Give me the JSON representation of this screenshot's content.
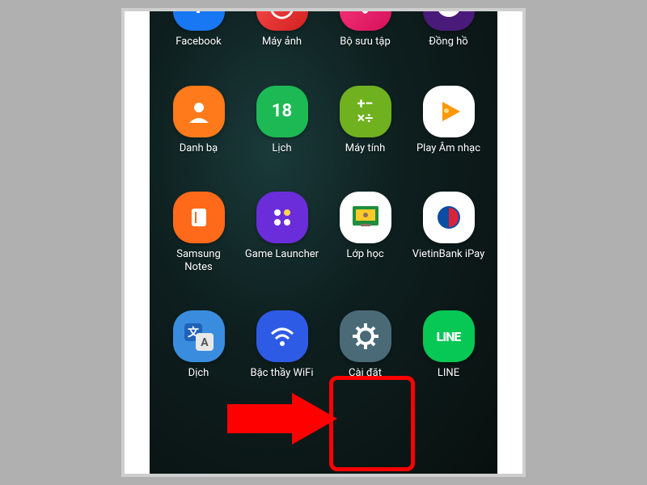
{
  "annotation": {
    "highlight_target": "settings-app",
    "arrow_color": "#ff0000"
  },
  "rows": [
    [
      {
        "id": "facebook",
        "label": "Facebook",
        "glyph": "f",
        "cls": "bg-fb"
      },
      {
        "id": "camera",
        "label": "Máy ảnh",
        "glyph": "◯",
        "cls": "bg-camera"
      },
      {
        "id": "gallery",
        "label": "Bộ sưu tập",
        "glyph": "✽",
        "cls": "bg-gallery"
      },
      {
        "id": "clock",
        "label": "Đồng hồ",
        "glyph": "◐",
        "cls": "bg-clock"
      }
    ],
    [
      {
        "id": "contacts",
        "label": "Danh bạ",
        "glyph": "👤",
        "cls": "bg-contacts"
      },
      {
        "id": "calendar",
        "label": "Lịch",
        "glyph": "18",
        "cls": "bg-calendar"
      },
      {
        "id": "calculator",
        "label": "Máy tính",
        "glyph": "±×",
        "cls": "bg-calc sm"
      },
      {
        "id": "playmusic",
        "label": "Play Âm nhạc",
        "glyph": "▶",
        "cls": "bg-playmusic",
        "color": "#ff9800"
      }
    ],
    [
      {
        "id": "samsungnotes",
        "label": "Samsung Notes",
        "glyph": "▮",
        "cls": "bg-notes"
      },
      {
        "id": "gamelauncher",
        "label": "Game Launcher",
        "glyph": "⊞",
        "cls": "bg-gamelauncher"
      },
      {
        "id": "classroom",
        "label": "Lớp học",
        "glyph": "▭",
        "cls": "bg-classroom",
        "color": "#1e8e3e"
      },
      {
        "id": "vietinbank",
        "label": "VietinBank iPay",
        "glyph": "◐",
        "cls": "bg-vietinbank",
        "color": "#0b4da2"
      }
    ],
    [
      {
        "id": "translate",
        "label": "Dịch",
        "glyph": "文",
        "cls": "bg-translate"
      },
      {
        "id": "wifimaster",
        "label": "Bậc thầy WiFi",
        "glyph": "ᯤ",
        "cls": "bg-wifi"
      },
      {
        "id": "settings",
        "label": "Cài đặt",
        "glyph": "⚙",
        "cls": "bg-settings"
      },
      {
        "id": "line",
        "label": "LINE",
        "glyph": "LINE",
        "cls": "bg-line sm"
      }
    ]
  ]
}
